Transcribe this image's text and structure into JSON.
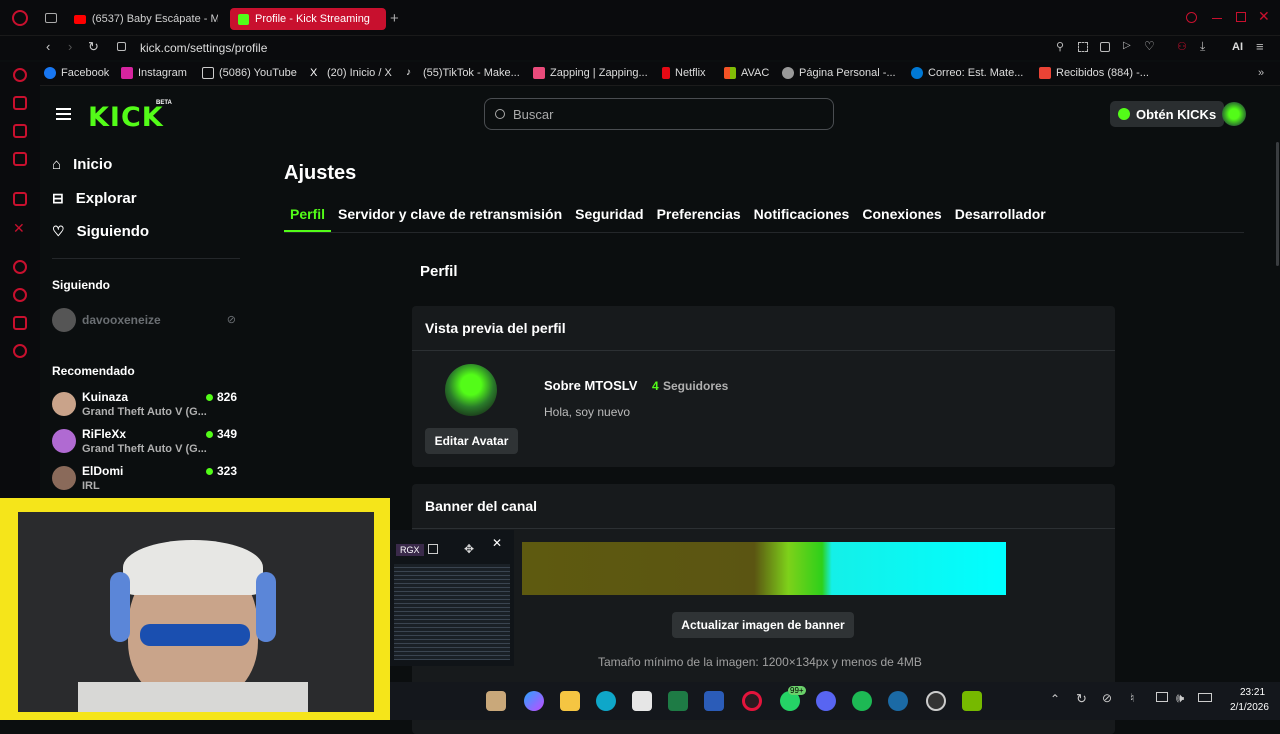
{
  "browser": {
    "tabs": [
      {
        "label": "(6537) Baby Escápate - M"
      },
      {
        "label": "Profile - Kick Streaming"
      }
    ],
    "url": "kick.com/settings/profile",
    "ai_label": "AI",
    "bookmarks": [
      "Facebook",
      "Instagram",
      "(5086) YouTube",
      "(20) Inicio / X",
      "(55)TikTok - Make...",
      "Zapping | Zapping...",
      "Netflix",
      "AVAC",
      "Página Personal -...",
      "Correo: Est. Mate...",
      "Recibidos (884) -..."
    ]
  },
  "header": {
    "logo": "KICK",
    "beta": "BETA",
    "search_placeholder": "Buscar",
    "kicks_label": "Obtén KICKs"
  },
  "nav": {
    "items": [
      {
        "label": "Inicio"
      },
      {
        "label": "Explorar"
      },
      {
        "label": "Siguiendo"
      }
    ]
  },
  "following": {
    "title": "Siguiendo",
    "channel": "davooxeneize"
  },
  "recommended": {
    "title": "Recomendado",
    "items": [
      {
        "name": "Kuinaza",
        "game": "Grand Theft Auto V (G...",
        "viewers": "826"
      },
      {
        "name": "RiFleXx",
        "game": "Grand Theft Auto V (G...",
        "viewers": "349"
      },
      {
        "name": "ElDomi",
        "game": "IRL",
        "viewers": "323"
      }
    ]
  },
  "settings": {
    "title": "Ajustes",
    "tabs": [
      "Perfil",
      "Servidor y clave de retransmisión",
      "Seguridad",
      "Preferencias",
      "Notificaciones",
      "Conexiones",
      "Desarrollador"
    ],
    "section": "Perfil",
    "preview": {
      "title": "Vista previa del perfil",
      "about": "Sobre MTOSLV",
      "followers_count": "4",
      "followers_label": "Seguidores",
      "bio": "Hola, soy nuevo",
      "edit_avatar": "Editar Avatar"
    },
    "banner": {
      "title": "Banner del canal",
      "update_button": "Actualizar imagen de banner",
      "hint": "Tamaño mínimo de la imagen: 1200×134px y menos de 4MB"
    }
  },
  "overlay": {
    "rgx": "RGX"
  },
  "taskbar": {
    "time": "23:21",
    "date": "2/1/2026",
    "badge": "99+"
  },
  "colors": {
    "accent": "#53fc18",
    "tab_active": "#c8102e",
    "cam_border": "#f5e51a"
  }
}
